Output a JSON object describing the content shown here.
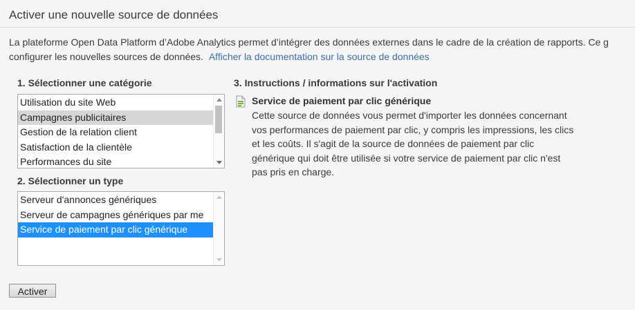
{
  "page": {
    "title": "Activer une nouvelle source de données",
    "intro_line1": "La plateforme Open Data Platform d’Adobe Analytics permet d’intégrer des données externes dans le cadre de la création de rapports. Ce g",
    "intro_line2": "configurer les nouvelles sources de données.",
    "doc_link": "Afficher la documentation sur la source de données"
  },
  "category": {
    "heading": "1. Sélectionner une catégorie",
    "options": [
      "Utilisation du site Web",
      "Campagnes publicitaires",
      "Gestion de la relation client",
      "Satisfaction de la clientèle",
      "Performances du site"
    ],
    "selected": "Campagnes publicitaires"
  },
  "type": {
    "heading": "2. Sélectionner un type",
    "options": [
      "Serveur d'annonces génériques",
      "Serveur de campagnes génériques par me",
      "Service de paiement par clic générique"
    ],
    "selected": "Service de paiement par clic générique"
  },
  "instructions": {
    "heading": "3. Instructions / informations sur l'activation",
    "item_title": "Service de paiement par clic générique",
    "text": "Cette source de données vous permet d'importer les données concernant vos performances de paiement par clic, y compris les impressions, les clics et les coûts. Il s'agit de la source de données de paiement par clic générique qui doit être utilisée si votre service de paiement par clic n'est pas pris en charge.",
    "icon": "datasource-icon"
  },
  "actions": {
    "activate_label": "Activer"
  },
  "colors": {
    "selection_blue": "#1e90ff",
    "selection_gray": "#d6d6d6",
    "link": "#3d6ea8"
  }
}
